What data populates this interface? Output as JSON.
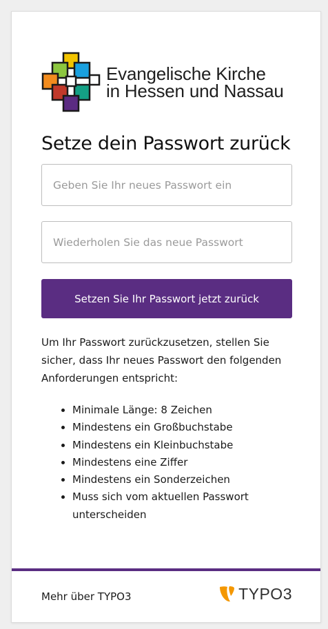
{
  "colors": {
    "accent": "#5a2d82",
    "typo3_orange": "#f49700",
    "logo_squares": [
      "#f2c400",
      "#8cc63f",
      "#1aa0de",
      "#f28c1e",
      "#c0392b",
      "#14a085",
      "#5b2b82"
    ]
  },
  "logo": {
    "icon": "ekhn-cross-logo-icon",
    "line1": "Evangelische Kirche",
    "line2": "in Hessen und Nassau"
  },
  "form": {
    "title": "Setze dein Passwort zurück",
    "password_placeholder": "Geben Sie Ihr neues Passwort ein",
    "repeat_placeholder": "Wiederholen Sie das neue Passwort",
    "submit_label": "Setzen Sie Ihr Passwort jetzt zurück"
  },
  "info": {
    "text": "Um Ihr Passwort zurückzusetzen, stellen Sie sicher, dass Ihr neues Passwort den folgenden Anforderungen entspricht:",
    "requirements": [
      "Minimale Länge: 8 Zeichen",
      "Mindestens ein Großbuchstabe",
      "Mindestens ein Kleinbuchstabe",
      "Mindestens eine Ziffer",
      "Mindestens ein Sonderzeichen",
      "Muss sich vom aktuellen Passwort unterscheiden"
    ]
  },
  "footer": {
    "more_link": "Mehr über TYPO3",
    "brand_icon": "typo3-icon",
    "brand": "TYPO3"
  }
}
